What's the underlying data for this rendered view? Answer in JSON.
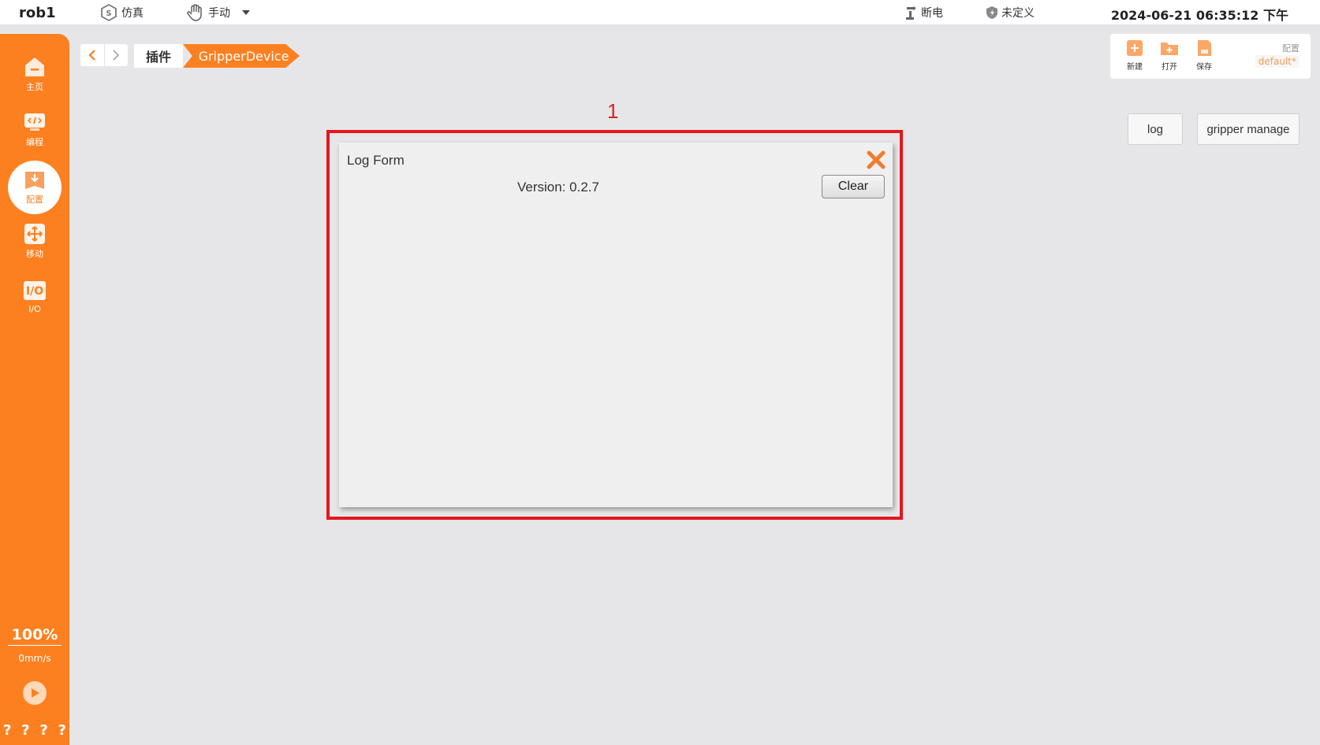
{
  "topbar": {
    "robot_name": "rob1",
    "sim_label": "仿真",
    "mode_label": "手动",
    "power_label": "断电",
    "safety_label": "未定义",
    "datetime": "2024-06-21 06:35:12 下午"
  },
  "sidebar": {
    "items": [
      {
        "label": "主页",
        "icon": "home-icon"
      },
      {
        "label": "编程",
        "icon": "code-icon"
      },
      {
        "label": "配置",
        "icon": "config-icon",
        "active": true
      },
      {
        "label": "移动",
        "icon": "move-icon"
      },
      {
        "label": "I/O",
        "icon": "io-icon"
      }
    ],
    "speed_percent": "100%",
    "speed_value": "0mm/s",
    "status_marks": [
      "?",
      "?",
      "?",
      "?"
    ]
  },
  "breadcrumb": {
    "level1": "插件",
    "level2": "GripperDevice"
  },
  "file_panel": {
    "new_label": "新建",
    "open_label": "打开",
    "save_label": "保存",
    "config_label": "配置",
    "config_value": "default*"
  },
  "actions": {
    "log_label": "log",
    "gripper_manage_label": "gripper manage"
  },
  "annotation": {
    "number": "1"
  },
  "log_form": {
    "title": "Log Form",
    "version": "Version: 0.2.7",
    "clear_label": "Clear"
  },
  "colors": {
    "accent": "#fd8020",
    "highlight": "#e4161e",
    "background": "#e6e6e8"
  }
}
